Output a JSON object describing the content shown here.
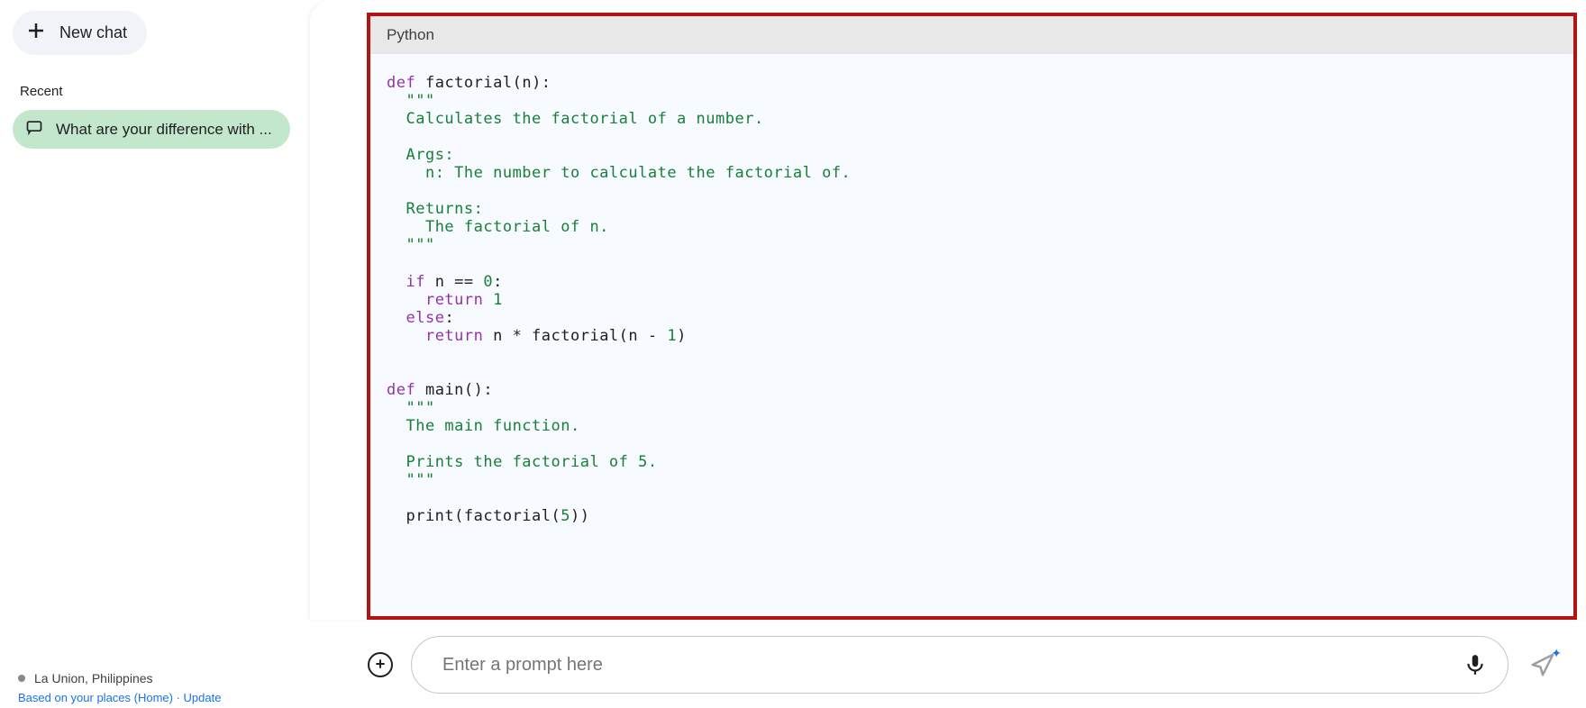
{
  "sidebar": {
    "new_chat_label": "New chat",
    "recent_label": "Recent",
    "items": [
      {
        "label": "What are your difference with ..."
      }
    ],
    "location": "La Union, Philippines",
    "location_sub": "Based on your places (Home) · Update"
  },
  "code": {
    "language": "Python",
    "tokens": [
      [
        [
          "kw",
          "def"
        ],
        [
          "op",
          " "
        ],
        [
          "fn",
          "factorial"
        ],
        [
          "op",
          "(n):"
        ]
      ],
      [
        [
          "op",
          "  "
        ],
        [
          "str",
          "\"\"\""
        ]
      ],
      [
        [
          "op",
          "  "
        ],
        [
          "str",
          "Calculates the factorial of a number."
        ]
      ],
      [
        [
          "op",
          ""
        ]
      ],
      [
        [
          "op",
          "  "
        ],
        [
          "str",
          "Args:"
        ]
      ],
      [
        [
          "op",
          "    "
        ],
        [
          "str",
          "n: The number to calculate the factorial of."
        ]
      ],
      [
        [
          "op",
          ""
        ]
      ],
      [
        [
          "op",
          "  "
        ],
        [
          "str",
          "Returns:"
        ]
      ],
      [
        [
          "op",
          "    "
        ],
        [
          "str",
          "The factorial of n."
        ]
      ],
      [
        [
          "op",
          "  "
        ],
        [
          "str",
          "\"\"\""
        ]
      ],
      [
        [
          "op",
          ""
        ]
      ],
      [
        [
          "op",
          "  "
        ],
        [
          "kw",
          "if"
        ],
        [
          "op",
          " n == "
        ],
        [
          "num",
          "0"
        ],
        [
          "op",
          ":"
        ]
      ],
      [
        [
          "op",
          "    "
        ],
        [
          "kw",
          "return"
        ],
        [
          "op",
          " "
        ],
        [
          "num",
          "1"
        ]
      ],
      [
        [
          "op",
          "  "
        ],
        [
          "kw",
          "else"
        ],
        [
          "op",
          ":"
        ]
      ],
      [
        [
          "op",
          "    "
        ],
        [
          "kw",
          "return"
        ],
        [
          "op",
          " n * factorial(n - "
        ],
        [
          "num",
          "1"
        ],
        [
          "op",
          ")"
        ]
      ],
      [
        [
          "op",
          ""
        ]
      ],
      [
        [
          "op",
          ""
        ]
      ],
      [
        [
          "kw",
          "def"
        ],
        [
          "op",
          " "
        ],
        [
          "fn",
          "main"
        ],
        [
          "op",
          "():"
        ]
      ],
      [
        [
          "op",
          "  "
        ],
        [
          "str",
          "\"\"\""
        ]
      ],
      [
        [
          "op",
          "  "
        ],
        [
          "str",
          "The main function."
        ]
      ],
      [
        [
          "op",
          ""
        ]
      ],
      [
        [
          "op",
          "  "
        ],
        [
          "str",
          "Prints the factorial of 5."
        ]
      ],
      [
        [
          "op",
          "  "
        ],
        [
          "str",
          "\"\"\""
        ]
      ],
      [
        [
          "op",
          ""
        ]
      ],
      [
        [
          "op",
          "  print(factorial("
        ],
        [
          "num",
          "5"
        ],
        [
          "op",
          "))"
        ]
      ]
    ]
  },
  "prompt": {
    "placeholder": "Enter a prompt here"
  }
}
